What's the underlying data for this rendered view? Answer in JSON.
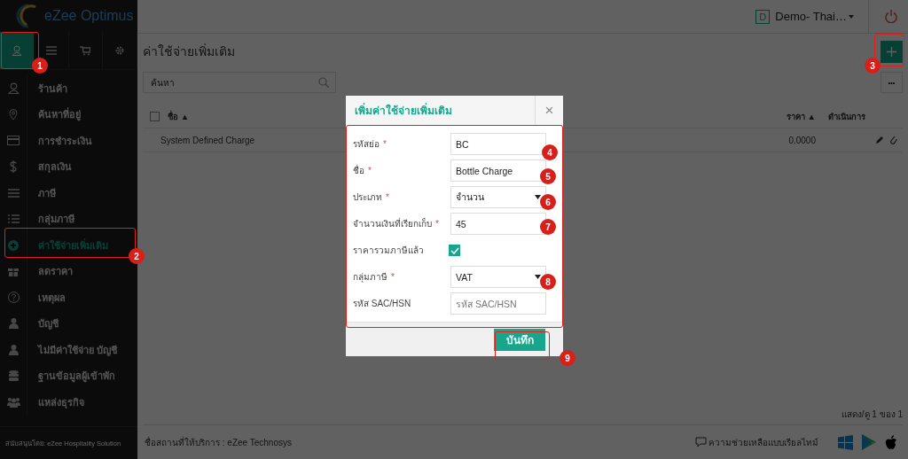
{
  "brand": {
    "name": "eZee Optimus"
  },
  "sidebar": {
    "tabs": [
      {
        "selected": true
      },
      {
        "selected": false
      },
      {
        "selected": false
      },
      {
        "selected": false
      }
    ],
    "items": [
      {
        "label": "ร้านค้า",
        "selected": false
      },
      {
        "label": "ค้นหาที่อยู่",
        "selected": false
      },
      {
        "label": "การชำระเงิน",
        "selected": false
      },
      {
        "label": "สกุลเงิน",
        "selected": false
      },
      {
        "label": "ภาษี",
        "selected": false
      },
      {
        "label": "กลุ่มภาษี",
        "selected": false
      },
      {
        "label": "ค่าใช้จ่ายเพิ่มเติม",
        "selected": true
      },
      {
        "label": "ลดราคา",
        "selected": false
      },
      {
        "label": "เหตุผล",
        "selected": false
      },
      {
        "label": "บัญชี",
        "selected": false
      },
      {
        "label": "ไม่มีค่าใช้จ่าย บัญชี",
        "selected": false
      },
      {
        "label": "ฐานข้อมูลผู้เข้าพัก",
        "selected": false
      },
      {
        "label": "แหล่งธุรกิจ",
        "selected": false
      }
    ],
    "footer": "สนับสนุนโดย: eZee Hospitality Solution"
  },
  "topbar": {
    "badge": "D",
    "property": "Demo- Thai…"
  },
  "page": {
    "title": "ค่าใช้จ่ายเพิ่มเติม",
    "search": {
      "placeholder": "ค้นหา"
    },
    "more": "•••"
  },
  "table": {
    "select_all": {
      "checked": false
    },
    "columns": [
      {
        "label": "ชื่อ ▲"
      },
      {
        "label": "ราคา ▲"
      },
      {
        "label": "ดำเนินการ"
      }
    ],
    "rows": [
      {
        "name": "System Defined Charge",
        "price": "0.0000"
      }
    ]
  },
  "pager": "แสดง/ดู 1 ของ 1",
  "status_bar": {
    "provider": "ชื่อสถานที่ให้บริการ : eZee Technosys",
    "help": "ความช่วยเหลือแบบเรียลไทม์"
  },
  "dialog": {
    "title": "เพิ่มค่าใช้จ่ายเพิ่มเติม",
    "close": "×",
    "fields": [
      {
        "kind": "text",
        "label": "รหัสย่อ",
        "required_mark": "*",
        "value": "BC"
      },
      {
        "kind": "text",
        "label": "ชื่อ",
        "required_mark": "*",
        "value": "Bottle Charge"
      },
      {
        "kind": "select",
        "label": "ประเภท",
        "required_mark": "*",
        "value": "จำนวน"
      },
      {
        "kind": "text",
        "label": "จำนวนเงินที่เรียกเก็บ",
        "required_mark": "*",
        "value": "45"
      },
      {
        "kind": "checkbox",
        "label": "ราคารวมภาษีแล้ว",
        "checked": true
      },
      {
        "kind": "select",
        "label": "กลุ่มภาษี",
        "required_mark": "*",
        "value": "VAT"
      },
      {
        "kind": "text",
        "label": "รหัส SAC/HSN",
        "placeholder": "รหัส SAC/HSN"
      }
    ],
    "save": "บันทึก"
  },
  "annotations": [
    {
      "number": "1"
    },
    {
      "number": "2"
    },
    {
      "number": "3"
    },
    {
      "number": "4"
    },
    {
      "number": "5"
    },
    {
      "number": "6"
    },
    {
      "number": "7"
    },
    {
      "number": "8"
    },
    {
      "number": "9"
    }
  ]
}
